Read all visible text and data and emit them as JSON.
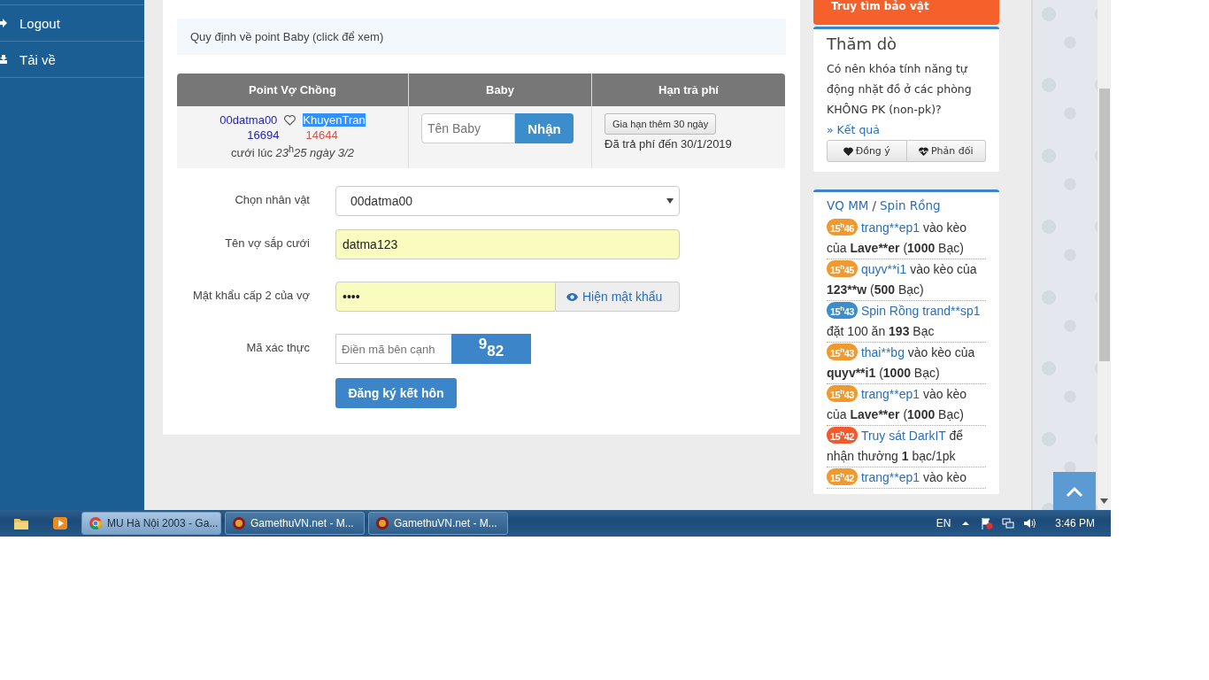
{
  "sidebar": {
    "items": [
      {
        "label": "Logout",
        "kind": "logout"
      },
      {
        "label": "Tải về",
        "kind": "download"
      }
    ]
  },
  "notice": "Quy định về point Baby (click để xem)",
  "couple_table": {
    "columns": [
      "Point Vợ Chồng",
      "Baby",
      "Hạn trả phí"
    ],
    "row": {
      "husband": "00datma00",
      "wife": {
        "name": "KhuyenTran",
        "highlighted": true
      },
      "husband_points": "16694",
      "wife_points": "14644",
      "married_at": "cưới lúc *23*$^{h}$*25 ngày 3/2*",
      "baby_field": {
        "placeholder": "Tên Baby"
      },
      "baby_button": "Nhận",
      "extend_button": "Gia hạn thêm 30 ngày",
      "paid_until": "Đã trả phí đến 30/1/2019"
    }
  },
  "form": {
    "fields": [
      {
        "kind": "select",
        "label": "Chọn nhân vật",
        "value": "00datma00"
      },
      {
        "kind": "text",
        "label": "Tên vợ sắp cưới",
        "value": "datma123",
        "autofilled": true
      },
      {
        "kind": "password",
        "label": "Mật khẩu cấp 2 của vợ",
        "value": "••••",
        "autofilled": true,
        "addon": "Hiện mật khẩu"
      },
      {
        "kind": "captcha",
        "label": "Mã xác thực",
        "placeholder": "Điền mã bên cạnh",
        "captcha": [
          "9",
          "82"
        ]
      }
    ],
    "submit": "Đăng ký kết hôn"
  },
  "right": {
    "banner": "Truy tìm bảo vật",
    "poll": {
      "title": "Thăm dò",
      "question": "Có nên khóa tính năng tự động nhặt đồ ở các phòng KHÔNG PK (non-pk)?",
      "result_link": "» Kết quả",
      "buttons": [
        {
          "label": "Đồng ý",
          "kind": "agree"
        },
        {
          "label": "Phản đối",
          "kind": "disagree"
        }
      ]
    },
    "feed": {
      "title_links": [
        "VQ MM",
        "Spin Rồng"
      ],
      "separator": "/",
      "items": [
        {
          "time": "15$^{h}$46",
          "color": "#f0992e",
          "parts": [
            {
              "kind": "link",
              "text": "trang**ep1"
            },
            {
              "kind": "plain",
              "text": " vào kèo của "
            },
            {
              "kind": "bold",
              "text": "Lave**er"
            },
            {
              "kind": "plain",
              "text": " ("
            },
            {
              "kind": "bold",
              "text": "1000"
            },
            {
              "kind": "plain",
              "text": " Bạc)"
            }
          ]
        },
        {
          "time": "15$^{h}$45",
          "color": "#f0992e",
          "parts": [
            {
              "kind": "link",
              "text": "quyv**i1"
            },
            {
              "kind": "plain",
              "text": " vào kèo của "
            },
            {
              "kind": "bold",
              "text": "123**w"
            },
            {
              "kind": "plain",
              "text": " ("
            },
            {
              "kind": "bold",
              "text": "500"
            },
            {
              "kind": "plain",
              "text": " Bạc)"
            }
          ]
        },
        {
          "time": "15$^{h}$43",
          "color": "#3c8dcb",
          "parts": [
            {
              "kind": "link",
              "text": "Spin Rồng trand**sp1"
            },
            {
              "kind": "plain",
              "text": " đặt 100 ăn "
            },
            {
              "kind": "bold",
              "text": "193"
            },
            {
              "kind": "plain",
              "text": " Bạc"
            }
          ]
        },
        {
          "time": "15$^{h}$43",
          "color": "#f0992e",
          "parts": [
            {
              "kind": "link",
              "text": "thai**bg"
            },
            {
              "kind": "plain",
              "text": " vào kèo của "
            },
            {
              "kind": "bold",
              "text": "quyv**i1"
            },
            {
              "kind": "plain",
              "text": " ("
            },
            {
              "kind": "bold",
              "text": "1000"
            },
            {
              "kind": "plain",
              "text": " Bạc)"
            }
          ]
        },
        {
          "time": "15$^{h}$43",
          "color": "#f0992e",
          "parts": [
            {
              "kind": "link",
              "text": "trang**ep1"
            },
            {
              "kind": "plain",
              "text": " vào kèo của "
            },
            {
              "kind": "bold",
              "text": "Lave**er"
            },
            {
              "kind": "plain",
              "text": " ("
            },
            {
              "kind": "bold",
              "text": "1000"
            },
            {
              "kind": "plain",
              "text": " Bạc)"
            }
          ]
        },
        {
          "time": "15$^{h}$42",
          "color": "#f05a2e",
          "parts": [
            {
              "kind": "link",
              "text": "Truy sát DarkIT"
            },
            {
              "kind": "plain",
              "text": " để nhận thưởng "
            },
            {
              "kind": "bold",
              "text": "1"
            },
            {
              "kind": "plain",
              "text": " bạc/1pk"
            }
          ]
        },
        {
          "time": "15$^{h}$42",
          "color": "#f0992e",
          "parts": [
            {
              "kind": "link",
              "text": "trang**ep1"
            },
            {
              "kind": "plain",
              "text": " vào kèo"
            }
          ]
        }
      ]
    }
  },
  "taskbar": {
    "pinned": [
      {
        "kind": "folder"
      },
      {
        "kind": "media"
      }
    ],
    "tasks": [
      {
        "label": "MU Hà Nội 2003 - Ga...",
        "kind": "browser",
        "selected": true
      },
      {
        "label": "GamethuVN.net - M...",
        "kind": "game",
        "selected": false
      },
      {
        "label": "GamethuVN.net - M...",
        "kind": "game",
        "selected": false
      }
    ],
    "language": "EN",
    "clock": "3:46 PM"
  }
}
